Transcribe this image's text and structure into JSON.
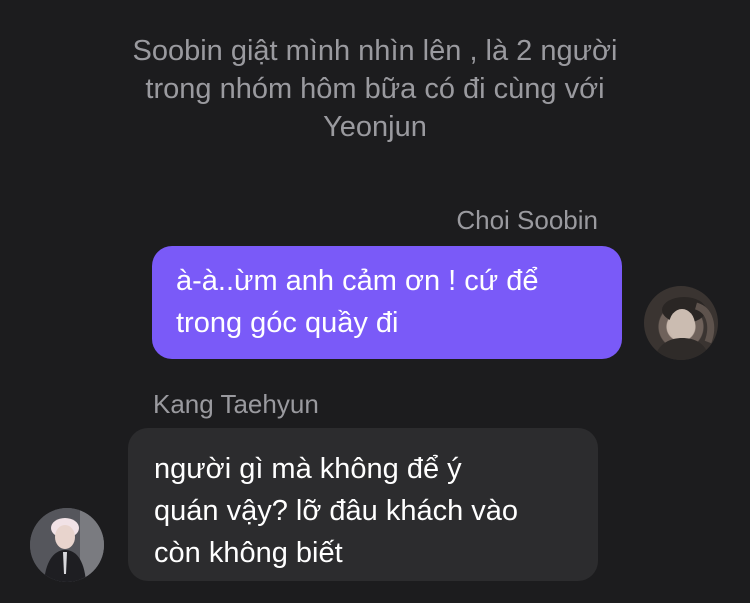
{
  "narration": {
    "line1": "Soobin giật mình nhìn lên , là 2 người",
    "line2": "trong nhóm hôm bữa có đi cùng với",
    "line3": "Yeonjun"
  },
  "messages": [
    {
      "sender": "Choi Soobin",
      "text_line1": "à-à..ừm anh cảm ơn ! cứ để",
      "text_line2": "trong góc quầy đi",
      "side": "right",
      "bubble_color": "#7a5af8"
    },
    {
      "sender": "Kang Taehyun",
      "text_line1": "người gì mà không để ý",
      "text_line2": "quán vậy? lỡ đâu khách vào",
      "text_line3": "còn không biết",
      "side": "left",
      "bubble_color": "#2c2c2e"
    }
  ],
  "icons": {
    "avatar_right": "avatar-soobin",
    "avatar_left": "avatar-taehyun"
  }
}
